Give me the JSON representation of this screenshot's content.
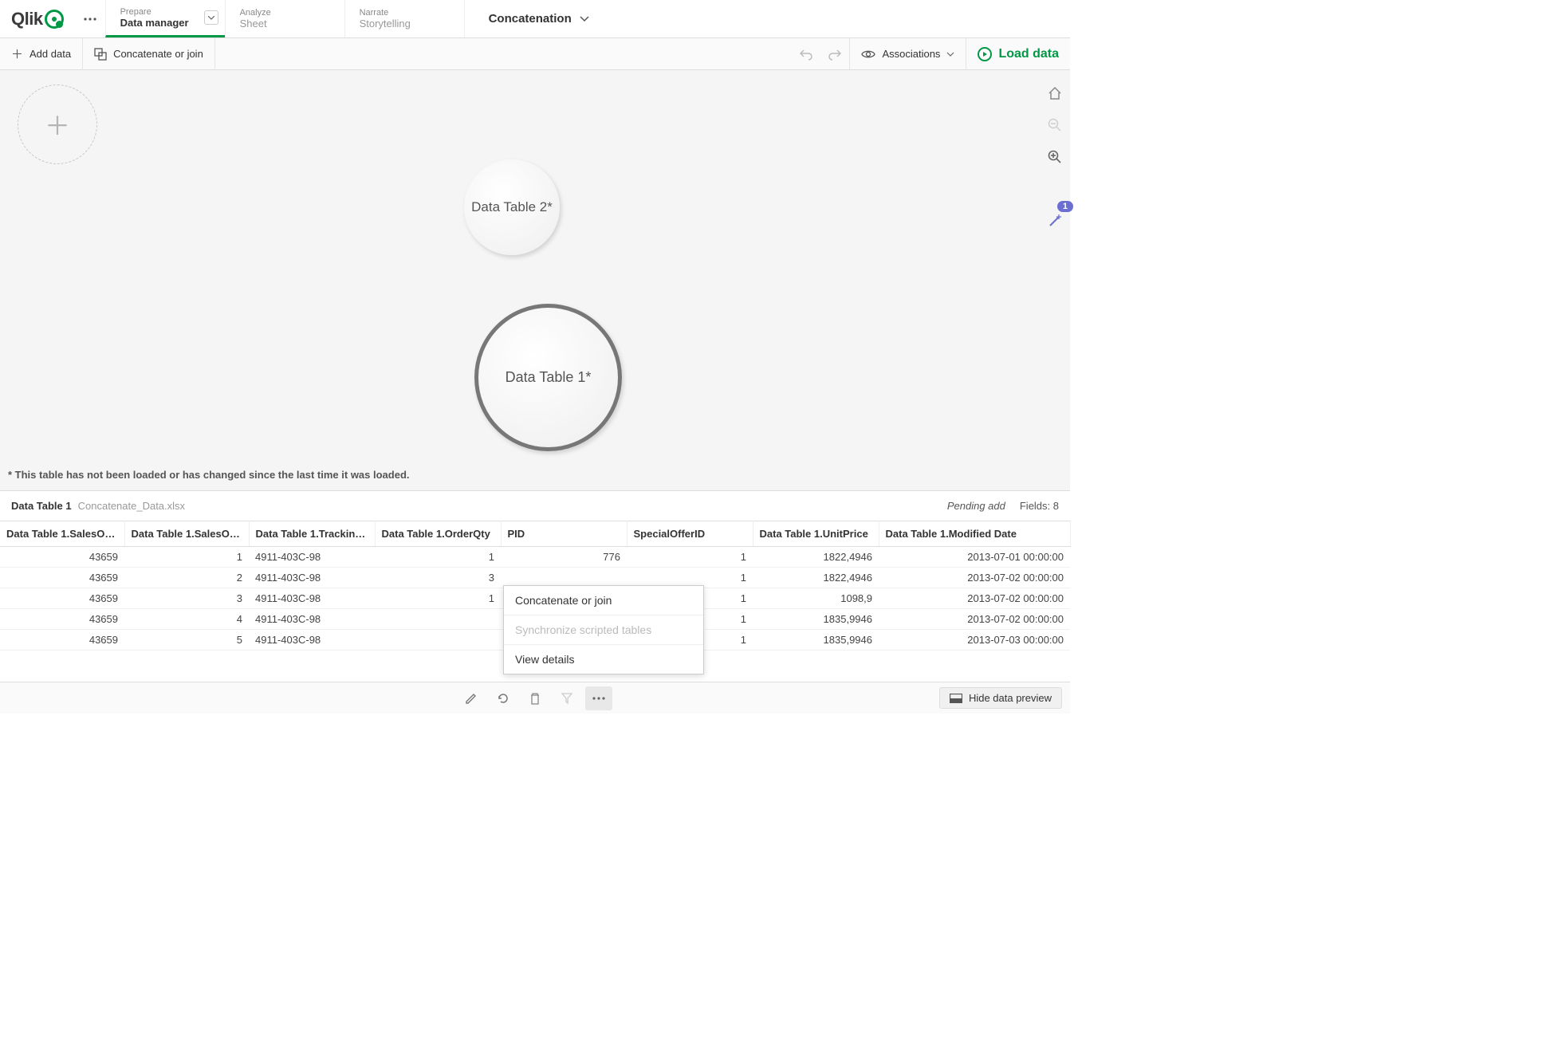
{
  "logo": {
    "text": "Qlik"
  },
  "nav": {
    "tabs": [
      {
        "top": "Prepare",
        "bottom": "Data manager"
      },
      {
        "top": "Analyze",
        "bottom": "Sheet"
      },
      {
        "top": "Narrate",
        "bottom": "Storytelling"
      }
    ]
  },
  "app_name": "Concatenation",
  "sub_toolbar": {
    "add_data": "Add data",
    "concat_join": "Concatenate or join",
    "associations": "Associations",
    "load_data": "Load data"
  },
  "canvas": {
    "bubbles": [
      {
        "label": "Data Table 2*"
      },
      {
        "label": "Data Table 1*"
      }
    ],
    "footnote": "* This table has not been loaded or has changed since the last time it was loaded.",
    "wand_badge": "1"
  },
  "preview": {
    "title": "Data Table 1",
    "file": "Concatenate_Data.xlsx",
    "pending": "Pending add",
    "fields_label": "Fields: 8"
  },
  "table": {
    "headers": [
      "Data Table 1.SalesOr…",
      "Data Table 1.SalesOr…",
      "Data Table 1.Tracking…",
      "Data Table 1.OrderQty",
      "PID",
      "SpecialOfferID",
      "Data Table 1.UnitPrice",
      "Data Table 1.Modified Date"
    ],
    "rows": [
      [
        "43659",
        "1",
        "4911-403C-98",
        "1",
        "776",
        "1",
        "1822,4946",
        "2013-07-01 00:00:00"
      ],
      [
        "43659",
        "2",
        "4911-403C-98",
        "3",
        "",
        "1",
        "1822,4946",
        "2013-07-02 00:00:00"
      ],
      [
        "43659",
        "3",
        "4911-403C-98",
        "1",
        "",
        "1",
        "1098,9",
        "2013-07-02 00:00:00"
      ],
      [
        "43659",
        "4",
        "4911-403C-98",
        "",
        "",
        "1",
        "1835,9946",
        "2013-07-02 00:00:00"
      ],
      [
        "43659",
        "5",
        "4911-403C-98",
        "",
        "",
        "1",
        "1835,9946",
        "2013-07-03 00:00:00"
      ]
    ],
    "alignments": [
      "num",
      "num",
      "",
      "num",
      "num",
      "num",
      "num",
      "num"
    ]
  },
  "context_menu": {
    "items": [
      {
        "label": "Concatenate or join",
        "disabled": false
      },
      {
        "label": "Synchronize scripted tables",
        "disabled": true
      },
      {
        "label": "View details",
        "disabled": false
      }
    ]
  },
  "bottom_bar": {
    "hide_preview": "Hide data preview"
  }
}
